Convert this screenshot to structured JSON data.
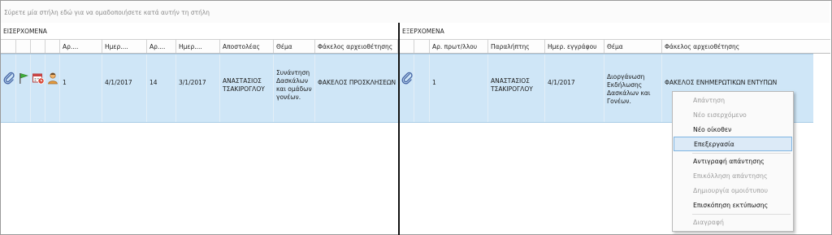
{
  "group_panel": {
    "hint": "Σύρετε μία στήλη εδώ για να ομαδοποιήσετε κατά αυτήν τη στήλη"
  },
  "incoming": {
    "title": "ΕΙΣΕΡΧΟΜΕΝΑ",
    "headers": [
      "Αρ....",
      "Ημερ....",
      "Αρ....",
      "Ημερ....",
      "Αποστολέας",
      "Θέμα",
      "Φάκελος αρχειοθέτησης"
    ],
    "row": {
      "icons": [
        "attachment-icon",
        "flag-icon",
        "calendar-icon",
        "user-icon"
      ],
      "no": "1",
      "date": "4/1/2017",
      "no2": "14",
      "date2": "3/1/2017",
      "sender": "ΑΝΑΣΤΑΣΙΟΣ ΤΣΑΚΙΡΟΓΛΟΥ",
      "subject": "Συνάντηση Δασκάλων και ομάδων γονέων.",
      "folder": "ΦΑΚΕΛΟΣ ΠΡΟΣΚΛΗΣΕΩΝ"
    }
  },
  "outgoing": {
    "title": "ΕΞΕΡΧΟΜΕΝΑ",
    "headers": [
      "Αρ. πρωτ/λλου",
      "Παραλήπτης",
      "Ημερ. εγγράφου",
      "Θέμα",
      "Φάκελος αρχειοθέτησης"
    ],
    "row": {
      "icons": [
        "attachment-icon"
      ],
      "no": "1",
      "recipient": "ΑΝΑΣΤΑΣΙΟΣ ΤΣΑΚΙΡΟΓΛΟΥ",
      "date": "4/1/2017",
      "subject": "Διοργάνωση Εκδήλωσης Δασκάλων και Γονέων.",
      "folder": "ΦΑΚΕΛΟΣ ΕΝΗΜΕΡΩΤΙΚΩΝ ΕΝΤΥΠΩΝ"
    }
  },
  "context_menu": {
    "items": [
      {
        "label": "Απάντηση",
        "enabled": false
      },
      {
        "label": "Νέο εισερχόμενο",
        "enabled": false
      },
      {
        "label": "Νέο οίκοθεν",
        "enabled": true
      },
      {
        "label": "Επεξεργασία",
        "enabled": true,
        "highlighted": true
      },
      {
        "label": "Αντιγραφή απάντησης",
        "enabled": true
      },
      {
        "label": "Επικόλληση απάντησης",
        "enabled": false
      },
      {
        "label": "Δημιουργία ομοιότυπου",
        "enabled": false
      },
      {
        "label": "Επισκόπηση εκτύπωσης",
        "enabled": true
      },
      {
        "label": "Διαγραφή",
        "enabled": false
      }
    ]
  },
  "colors": {
    "selection": "#cfe6f7",
    "menu_highlight": "#dceaf7"
  }
}
